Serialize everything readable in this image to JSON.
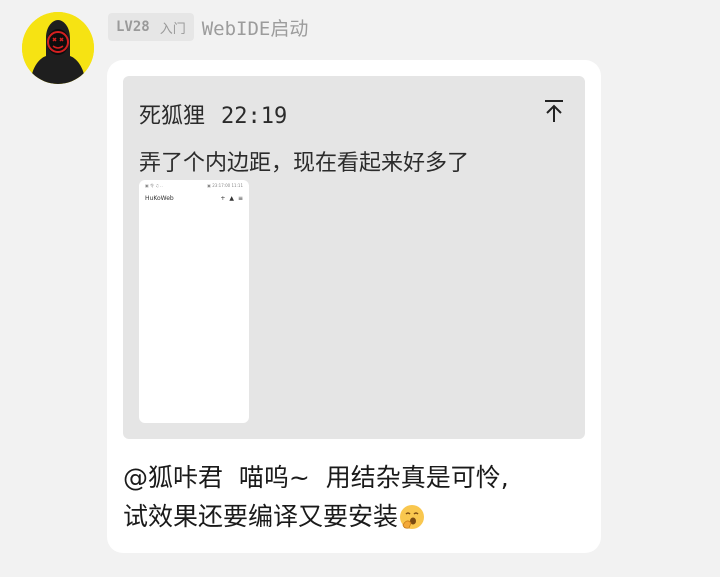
{
  "sender": {
    "level": "LV28",
    "rank": "入门",
    "name": "WebIDE启动"
  },
  "quote": {
    "author": "死狐狸",
    "time": "22:19",
    "text": "弄了个内边距，现在看起来好多了",
    "thumbnail": {
      "app_title": "HuKoWeb",
      "status_left": "▣ 令 ♫ ..",
      "status_right": "▣ 23:17:00 11:11"
    }
  },
  "message": {
    "mention": "@狐咔君",
    "line1_rest": "  喵呜~  用结杂真是可怜,",
    "line2": "试效果还要编译又要安装"
  },
  "colors": {
    "avatar_bg": "#f6e313",
    "bubble": "#ffffff",
    "quote_bg": "#e5e5e5",
    "page_bg": "#f2f2f2"
  }
}
